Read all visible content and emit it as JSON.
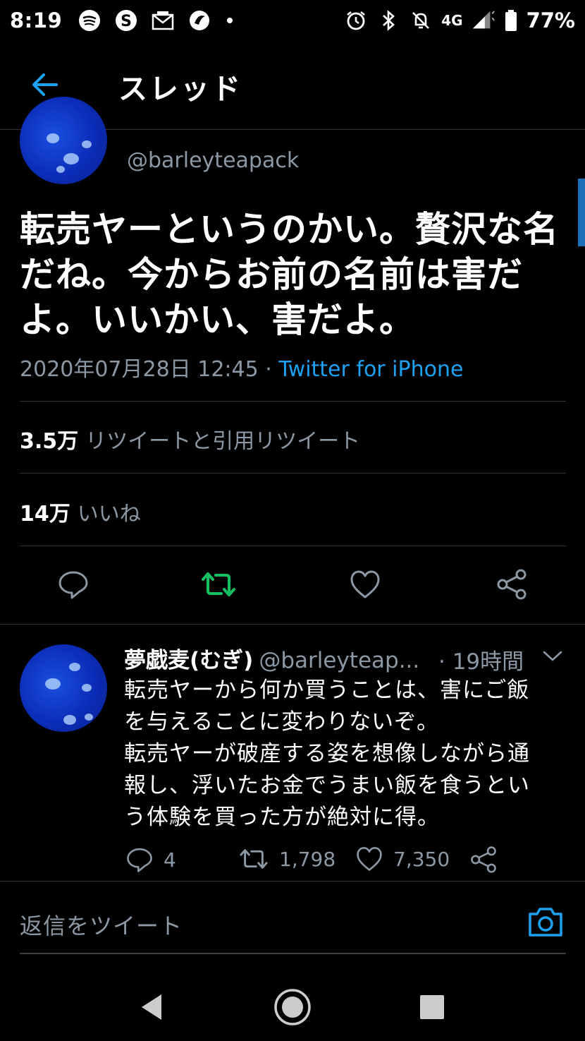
{
  "status_bar": {
    "time": "8:19",
    "network": "4G",
    "battery": "77%",
    "icons": [
      "spotify-icon",
      "skype-icon",
      "mail-icon",
      "app-icon",
      "alarm-icon",
      "bluetooth-icon",
      "mute-icon",
      "signal-icon",
      "battery-icon"
    ]
  },
  "header": {
    "title": "スレッド",
    "back_icon": "arrow-left-icon"
  },
  "main_tweet": {
    "handle": "@barleyteapack",
    "text_lines": [
      "転売ヤーというのかい。贅沢な名",
      "だね。今からお前の名前は害だ",
      "よ。いいかい、害だよ。"
    ],
    "timestamp": "2020年07月28日 12:45 · ",
    "source": "Twitter for iPhone",
    "retweets_count": "3.5万",
    "retweets_label": "リツイートと引用リツイート",
    "likes_count": "14万",
    "likes_label": "いいね",
    "colors": {
      "accent": "#1da1f2",
      "retweet_active": "#17bf63",
      "muted": "#8b98a5"
    }
  },
  "reply_tweet": {
    "name": "夢戯麦(むぎ)",
    "handle": "@barleyteap...",
    "time": "· 19時間",
    "text_lines": [
      "転売ヤーから何か買うことは、害にご飯",
      "を与えることに変わりないぞ。",
      "転売ヤーが破産する姿を想像しながら通",
      "報し、浮いたお金でうまい飯を食うとい",
      "う体験を買った方が絶対に得。"
    ],
    "reply_count": "4",
    "retweet_count": "1,798",
    "like_count": "7,350"
  },
  "composer": {
    "placeholder": "返信をツイート"
  }
}
